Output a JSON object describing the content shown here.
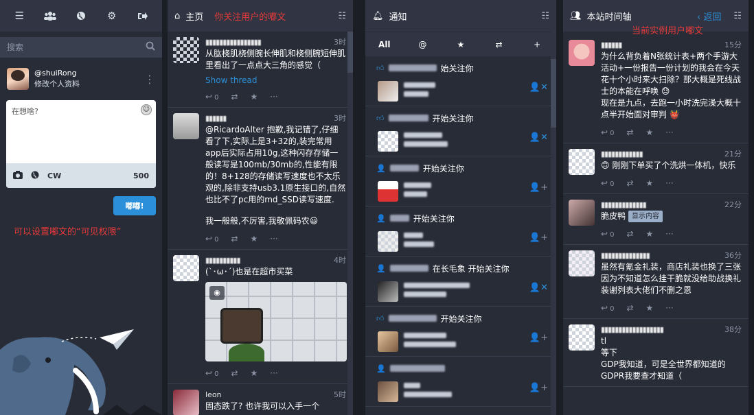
{
  "compose": {
    "search_placeholder": "搜索",
    "account": {
      "handle": "@shuiRong",
      "edit_label": "修改个人资料"
    },
    "textarea_placeholder": "在想啥?",
    "cw_label": "CW",
    "char_counter": "500",
    "toot_button": "嘟嘟!",
    "annotation": "可以设置嘟文的“可见权限”"
  },
  "home": {
    "title": "主页",
    "annotation": "你关注用户的嘟文",
    "statuses": [
      {
        "time": "3时",
        "text": [
          "从肱桡肌桡侧腕长伸肌和桡侧腕短伸肌里看出了一点点大三角的感觉（"
        ],
        "link": "Show thread",
        "reply_count": "0"
      },
      {
        "time": "3时",
        "text": [
          "@RicardoAlter 抱歉,我记错了,仔细看了下,实际上是3+32的,装完常用app后实际占用10g,这种闪存存储一般读写是100mb/30mb的,性能有限的！8+128的存储读写速度也不太乐观的,除非支持usb3.1原生接口的,自然也比不了pc用的md_SSD读写速度.",
          "我一般般,不厉害,我敬佩码农😃"
        ],
        "reply_count": "0"
      },
      {
        "time": "4时",
        "name": "",
        "text": [
          "(`･ω･´)也是在超市买菜"
        ],
        "reply_count": "0"
      },
      {
        "time": "5时",
        "name": "leon",
        "text": [
          "固态跌了? 也许我可以入手一个"
        ],
        "reply_count": "0"
      }
    ]
  },
  "notifications": {
    "title": "通知",
    "filters": [
      "All",
      "@",
      "★",
      "⇄",
      "+"
    ],
    "items": [
      {
        "action": "始关注你",
        "button": "remove"
      },
      {
        "action": "开始关注你",
        "button": "remove"
      },
      {
        "action": "开始关注你",
        "button": "add"
      },
      {
        "action": "开始关注你",
        "button": "add"
      },
      {
        "action": "在长毛象 开始关注你",
        "button": "remove"
      },
      {
        "action": "开始关注你",
        "button": "add"
      },
      {
        "action": "",
        "button": "add"
      }
    ]
  },
  "local": {
    "title": "本站时间轴",
    "back_label": "返回",
    "annotation": "当前实例用户嘟文",
    "statuses": [
      {
        "time": "15分",
        "text": [
          "为什么背负着N张统计表+两个手游大活动+一份报告一份计划的我会在今天花十个小时来大扫除？那大概是死线战士的本能在呼唤 😓",
          "现在是九点，去跑一小时洗完澡大概十点半开始面对审判 👹"
        ],
        "reply_count": "0"
      },
      {
        "time": "21分",
        "text": [
          "🙃 刚刚下单买了个洗烘一体机，快乐"
        ],
        "reply_count": "0"
      },
      {
        "time": "22分",
        "text": [
          "脆皮鸭"
        ],
        "badge": "显示内容",
        "reply_count": "0"
      },
      {
        "time": "36分",
        "text": [
          "虽然有氪金礼装，商店礼装也换了三张",
          "因为不知道怎么挂干脆就没给助战换礼装谢列表大佬们不删之恩"
        ],
        "reply_count": "0"
      },
      {
        "time": "38分",
        "text": [
          "tl",
          "等下",
          "GDP我知道，可是全世界都知道的GDPR我要查才知道（"
        ],
        "reply_count": "0"
      }
    ]
  }
}
